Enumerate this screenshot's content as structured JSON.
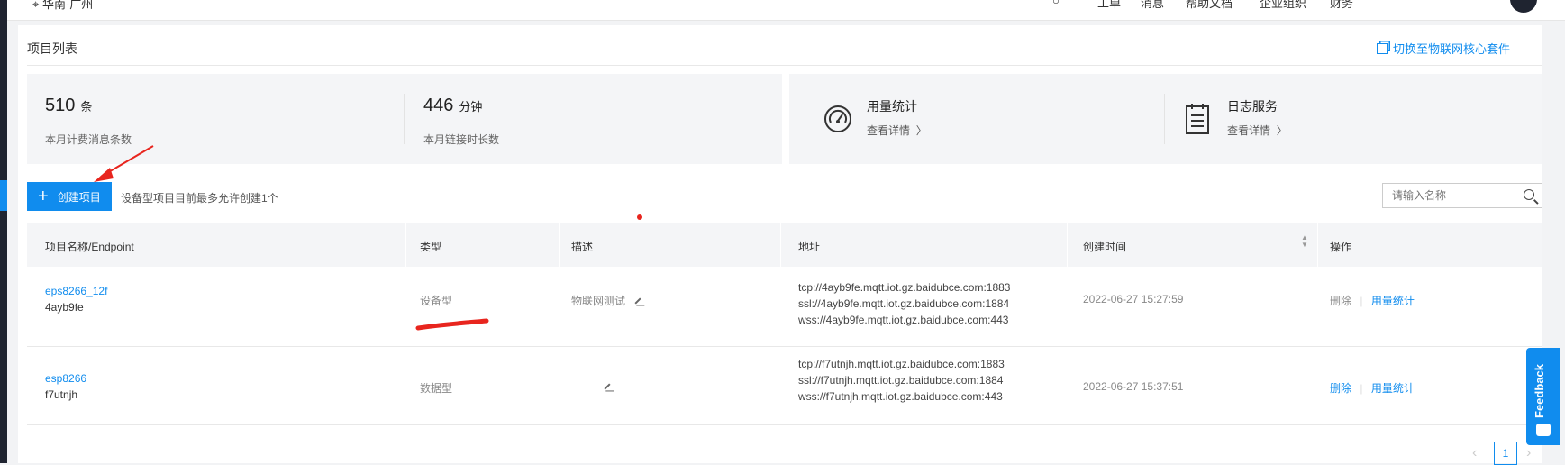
{
  "topbar": {
    "location": "华南-广州",
    "nav": [
      "工单",
      "消息",
      "帮助文档",
      "企业组织",
      "财务"
    ]
  },
  "page": {
    "title": "项目列表",
    "switch_link": "切换至物联网核心套件"
  },
  "stats": {
    "messages_value": "510",
    "messages_unit": "条",
    "messages_label": "本月计费消息条数",
    "duration_value": "446",
    "duration_unit": "分钟",
    "duration_label": "本月链接时长数"
  },
  "services": [
    {
      "title": "用量统计",
      "link": "查看详情",
      "icon": "gauge-icon"
    },
    {
      "title": "日志服务",
      "link": "查看详情",
      "icon": "log-document-icon"
    }
  ],
  "toolbar": {
    "create_label": "创建项目",
    "hint": "设备型项目目前最多允许创建1个",
    "search_placeholder": "请输入名称"
  },
  "table": {
    "headers": [
      "项目名称/Endpoint",
      "类型",
      "描述",
      "地址",
      "创建时间",
      "操作"
    ],
    "rows": [
      {
        "name": "eps8266_12f",
        "endpoint": "4ayb9fe",
        "type": "设备型",
        "description": "物联网测试",
        "addresses": [
          "tcp://4ayb9fe.mqtt.iot.gz.baidubce.com:1883",
          "ssl://4ayb9fe.mqtt.iot.gz.baidubce.com:1884",
          "wss://4ayb9fe.mqtt.iot.gz.baidubce.com:443"
        ],
        "created": "2022-06-27 15:27:59",
        "actions": {
          "delete": "删除",
          "stats": "用量统计"
        }
      },
      {
        "name": "esp8266",
        "endpoint": "f7utnjh",
        "type": "数据型",
        "description": "",
        "addresses": [
          "tcp://f7utnjh.mqtt.iot.gz.baidubce.com:1883",
          "ssl://f7utnjh.mqtt.iot.gz.baidubce.com:1884",
          "wss://f7utnjh.mqtt.iot.gz.baidubce.com:443"
        ],
        "created": "2022-06-27 15:37:51",
        "actions": {
          "delete": "删除",
          "stats": "用量统计"
        }
      }
    ]
  },
  "pagination": {
    "current": "1"
  },
  "feedback_label": "Feedback",
  "colors": {
    "accent": "#108cee",
    "annotation": "#e8251e"
  }
}
